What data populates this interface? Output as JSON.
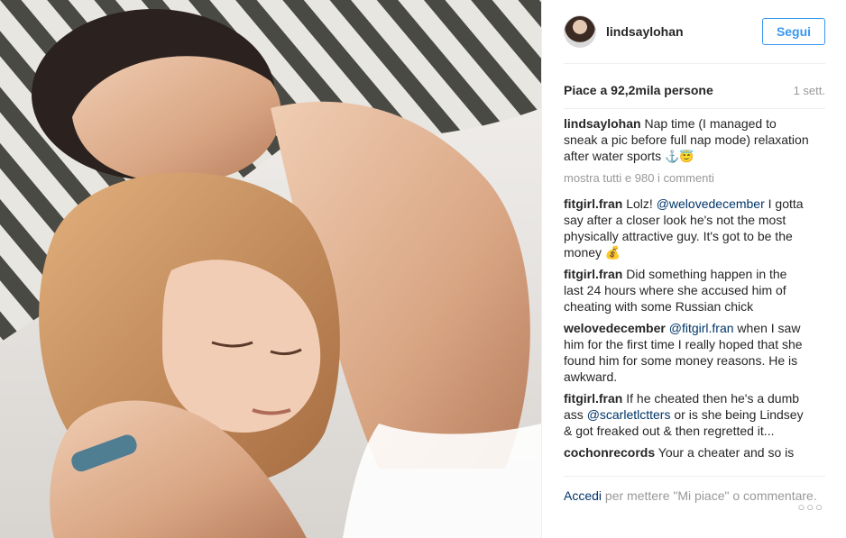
{
  "post": {
    "username": "lindsaylohan",
    "follow_label": "Segui",
    "likes": "Piace a 92,2mila persone",
    "time": "1 sett.",
    "caption": {
      "user": "lindsaylohan",
      "text": "Nap time (I managed to sneak a pic before full nap mode) relaxation after water sports",
      "emojis": "⚓😇"
    },
    "load_more": "mostra tutti e 980 i commenti",
    "comments": [
      {
        "user": "fitgirl.fran",
        "pre": "Lolz! ",
        "mention": "@welovedecember",
        "post": " I gotta say after a closer look he's not the most physically attractive guy. It's got to be the money 💰"
      },
      {
        "user": "fitgirl.fran",
        "pre": "Did something happen in the last 24 hours where she accused him of cheating with some Russian chick",
        "mention": "",
        "post": ""
      },
      {
        "user": "welovedecember",
        "pre": "",
        "mention": "@fitgirl.fran",
        "post": " when I saw him for the first time I really hoped that she found him for some money reasons. He is awkward."
      },
      {
        "user": "fitgirl.fran",
        "pre": "If he cheated then he's a dumb ass ",
        "mention": "@scarletlctters",
        "post": " or is she being Lindsey & got freaked out & then regretted it..."
      },
      {
        "user": "cochonrecords",
        "pre": "Your a cheater and so is",
        "mention": "",
        "post": ""
      }
    ],
    "footer": {
      "login": "Accedi",
      "rest": " per mettere \"Mi piace\" o commentare."
    },
    "more_dots": "○○○"
  }
}
